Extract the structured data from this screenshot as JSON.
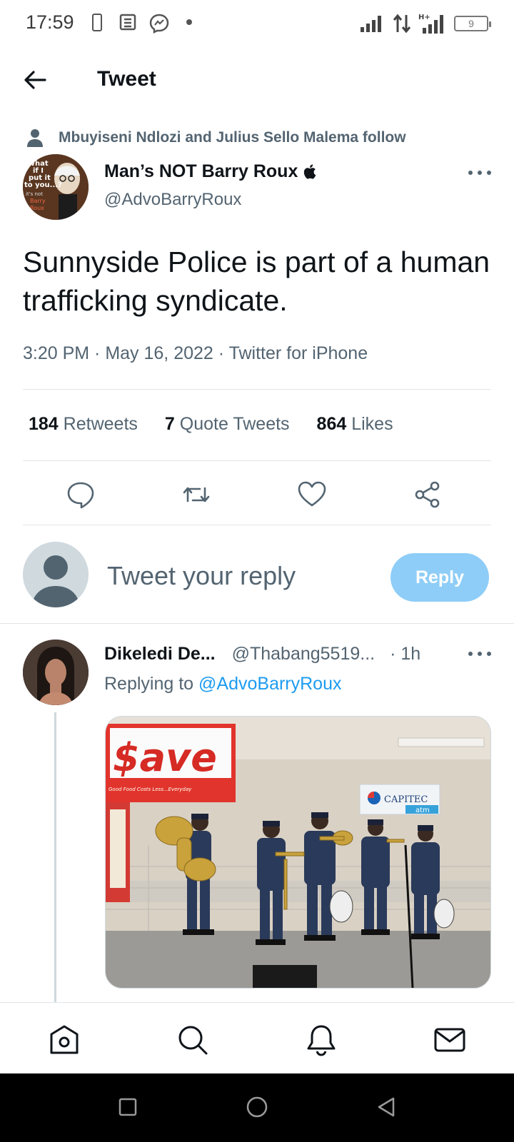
{
  "status_bar": {
    "time": "17:59",
    "battery": "9"
  },
  "header": {
    "title": "Tweet"
  },
  "social_context": "Mbuyiseni Ndlozi and Julius Sello Malema follow",
  "tweet": {
    "author_name": "Man’s NOT Barry Roux",
    "author_handle": "@AdvoBarryRoux",
    "avatar_caption": [
      "What",
      "if I",
      "put it",
      "to you...?",
      "it's not",
      "Barry",
      "Roux"
    ],
    "text": "Sunnyside Police is part of a human trafficking syndicate.",
    "meta": "3:20 PM · May 16, 2022 · Twitter for iPhone",
    "stats": [
      {
        "count": "184",
        "label": "Retweets"
      },
      {
        "count": "7",
        "label": "Quote Tweets"
      },
      {
        "count": "864",
        "label": "Likes"
      }
    ]
  },
  "composer": {
    "placeholder": "Tweet your reply",
    "button": "Reply"
  },
  "reply": {
    "name": "Dikeledi De...",
    "handle": "@Thabang5519...",
    "time": "· 1h",
    "replying_prefix": "Replying to",
    "replying_handle": "@AdvoBarryRoux",
    "image": {
      "store_sign": "$ave",
      "store_tagline": "Good Food Costs Less...Everyday",
      "atm_sign": "CAPITEC",
      "atm_sub": "atm"
    }
  },
  "colors": {
    "accent": "#1d9bf0",
    "reply_button": "#8ecdf7",
    "muted": "#536471"
  }
}
